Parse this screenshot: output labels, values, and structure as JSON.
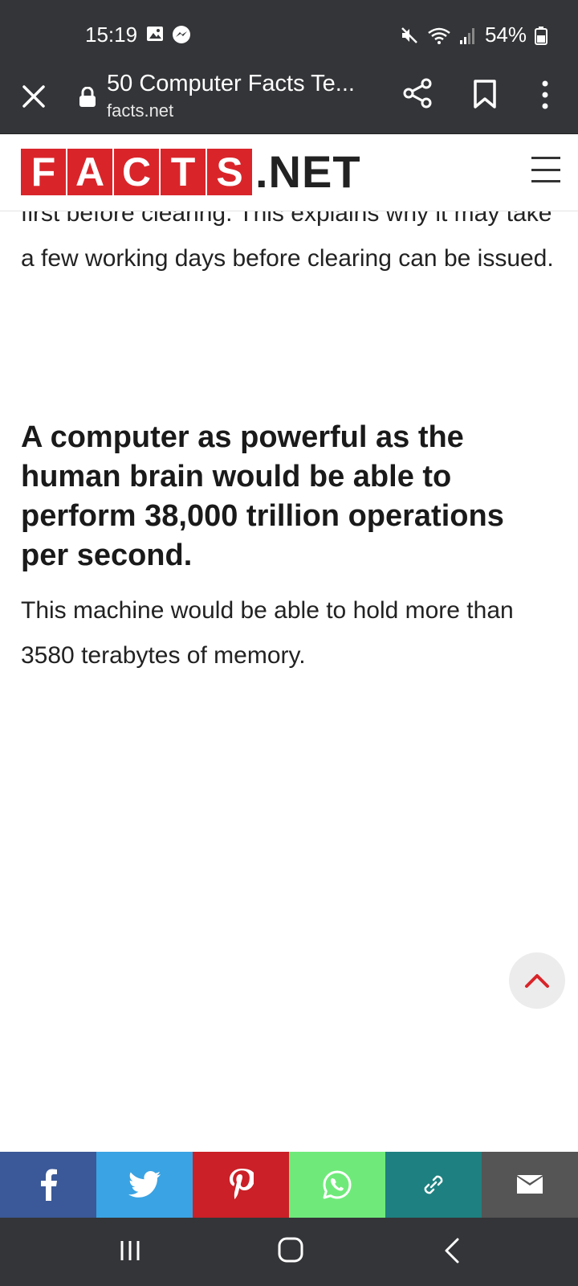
{
  "status_bar": {
    "time": "15:19",
    "battery": "54%",
    "left_icons": [
      "gallery-icon",
      "messenger-icon"
    ],
    "right_icons": [
      "mute-icon",
      "wifi-icon",
      "signal-icon",
      "battery-icon"
    ]
  },
  "browser": {
    "title": "50 Computer Facts Te...",
    "url": "facts.net"
  },
  "site": {
    "logo_letters": [
      "F",
      "A",
      "C",
      "T",
      "S"
    ],
    "logo_suffix": ".NET",
    "brand_color": "#d9252a"
  },
  "article": {
    "paragraph_partial": "first before clearing. This explains why it may take a few working days before clearing can be issued.",
    "heading": "A computer as powerful as the human brain would be able to perform 38,000 trillion operations per second.",
    "paragraph": "This machine would be able to hold more than 3580 terabytes of memory."
  },
  "share_bar": [
    {
      "name": "facebook",
      "color": "#3b5998",
      "icon": "facebook-icon"
    },
    {
      "name": "twitter",
      "color": "#3aa3e3",
      "icon": "twitter-icon"
    },
    {
      "name": "pinterest",
      "color": "#cb2027",
      "icon": "pinterest-icon"
    },
    {
      "name": "whatsapp",
      "color": "#6fea7a",
      "icon": "whatsapp-icon"
    },
    {
      "name": "copy-link",
      "color": "#1e8080",
      "icon": "link-icon"
    },
    {
      "name": "email",
      "color": "#555555",
      "icon": "email-icon"
    }
  ]
}
